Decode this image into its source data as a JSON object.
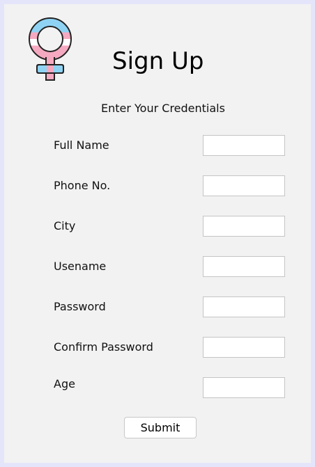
{
  "header": {
    "logo_icon": "venus-symbol-icon",
    "title": "Sign Up",
    "subtitle": "Enter Your Credentials"
  },
  "colors": {
    "frame_border": "#e4e4fb",
    "background": "#f2f2f2",
    "logo_blue": "#8fd3f4",
    "logo_pink": "#f5a9c0"
  },
  "form": {
    "fields": [
      {
        "label": "Full Name",
        "value": ""
      },
      {
        "label": "Phone No.",
        "value": ""
      },
      {
        "label": "City",
        "value": ""
      },
      {
        "label": "Usename",
        "value": ""
      },
      {
        "label": "Password",
        "value": ""
      },
      {
        "label": "Confirm Password",
        "value": ""
      },
      {
        "label": "Age",
        "value": ""
      }
    ],
    "submit_label": "Submit"
  }
}
